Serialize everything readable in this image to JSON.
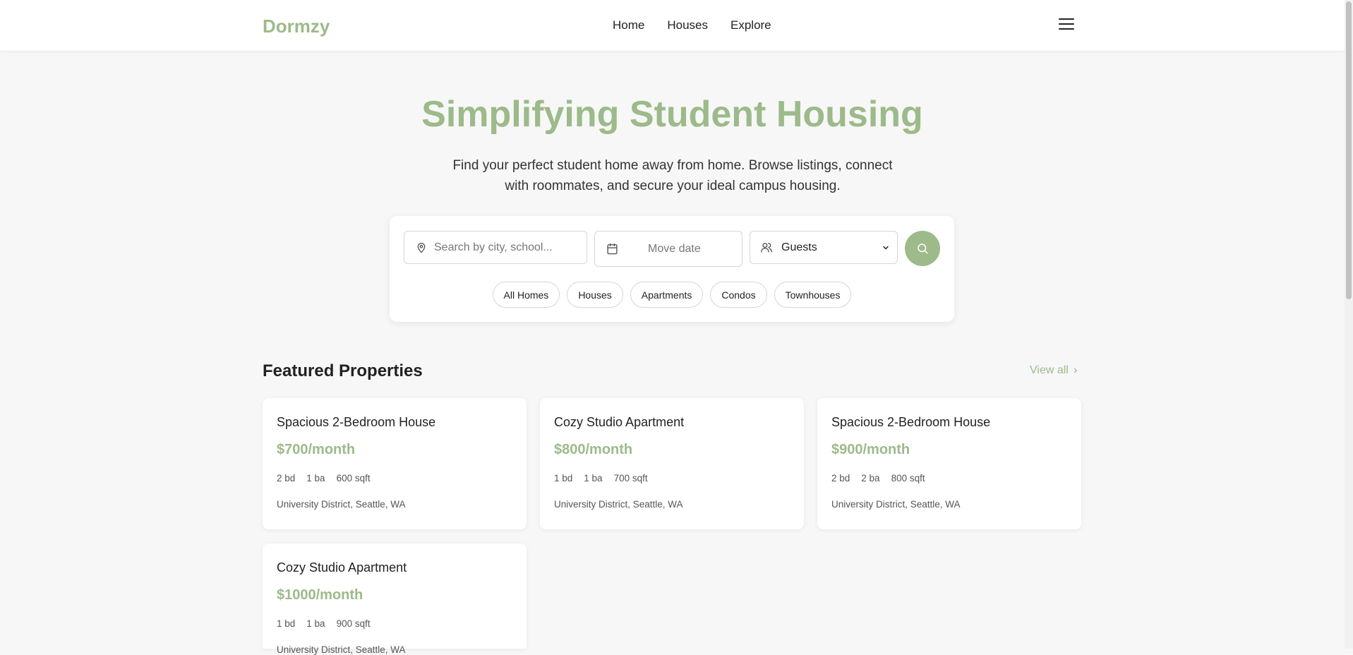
{
  "brand": {
    "logo": "Dormzy",
    "accent": "#9dba8a"
  },
  "nav": {
    "links": [
      "Home",
      "Houses",
      "Explore"
    ],
    "menu_icon": "hamburger-menu-icon"
  },
  "hero": {
    "title": "Simplifying Student Housing",
    "subtitle": "Find your perfect student home away from home. Browse listings, connect with roommates, and secure your ideal campus housing."
  },
  "search": {
    "location_placeholder": "Search by city, school...",
    "date_label": "Move date",
    "guests_label": "Guests",
    "filters": [
      "All Homes",
      "Houses",
      "Apartments",
      "Condos",
      "Townhouses"
    ]
  },
  "featured": {
    "title": "Featured Properties",
    "view_all": "View all",
    "properties": [
      {
        "title": "Spacious 2-Bedroom House",
        "price": "$700/month",
        "beds": "2 bd",
        "baths": "1 ba",
        "sqft": "600 sqft",
        "location": "University District, Seattle, WA"
      },
      {
        "title": "Cozy Studio Apartment",
        "price": "$800/month",
        "beds": "1 bd",
        "baths": "1 ba",
        "sqft": "700 sqft",
        "location": "University District, Seattle, WA"
      },
      {
        "title": "Spacious 2-Bedroom House",
        "price": "$900/month",
        "beds": "2 bd",
        "baths": "2 ba",
        "sqft": "800 sqft",
        "location": "University District, Seattle, WA"
      },
      {
        "title": "Cozy Studio Apartment",
        "price": "$1000/month",
        "beds": "1 bd",
        "baths": "1 ba",
        "sqft": "900 sqft",
        "location": "University District, Seattle, WA"
      }
    ]
  }
}
